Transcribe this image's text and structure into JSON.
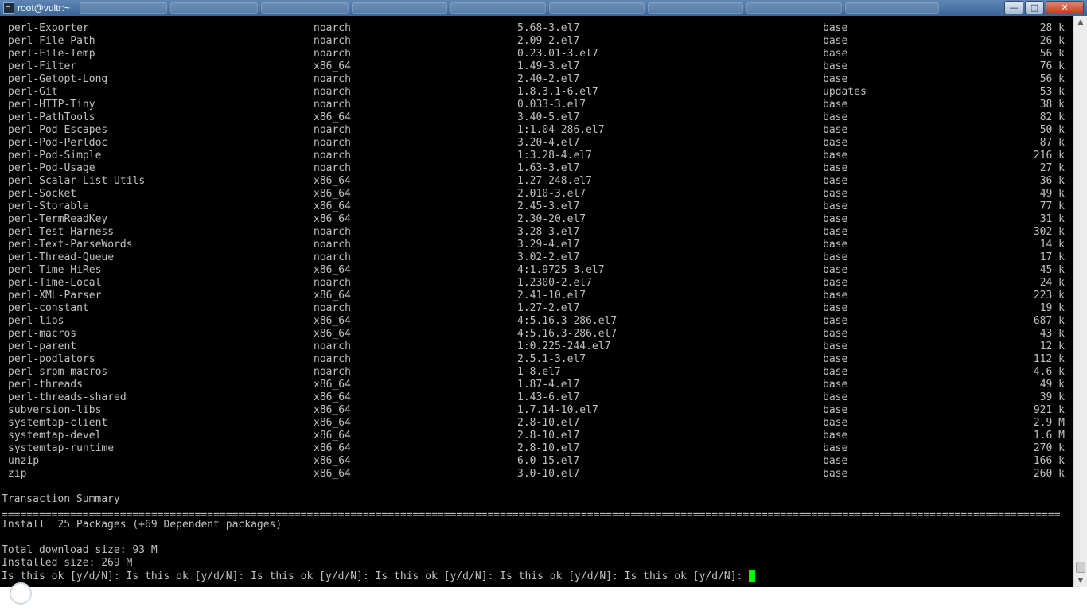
{
  "window": {
    "title": "root@vultr:~"
  },
  "packages": [
    {
      "name": "perl-Exporter",
      "arch": "noarch",
      "version": "5.68-3.el7",
      "repo": "base",
      "size": "28 k"
    },
    {
      "name": "perl-File-Path",
      "arch": "noarch",
      "version": "2.09-2.el7",
      "repo": "base",
      "size": "26 k"
    },
    {
      "name": "perl-File-Temp",
      "arch": "noarch",
      "version": "0.23.01-3.el7",
      "repo": "base",
      "size": "56 k"
    },
    {
      "name": "perl-Filter",
      "arch": "x86_64",
      "version": "1.49-3.el7",
      "repo": "base",
      "size": "76 k"
    },
    {
      "name": "perl-Getopt-Long",
      "arch": "noarch",
      "version": "2.40-2.el7",
      "repo": "base",
      "size": "56 k"
    },
    {
      "name": "perl-Git",
      "arch": "noarch",
      "version": "1.8.3.1-6.el7",
      "repo": "updates",
      "size": "53 k"
    },
    {
      "name": "perl-HTTP-Tiny",
      "arch": "noarch",
      "version": "0.033-3.el7",
      "repo": "base",
      "size": "38 k"
    },
    {
      "name": "perl-PathTools",
      "arch": "x86_64",
      "version": "3.40-5.el7",
      "repo": "base",
      "size": "82 k"
    },
    {
      "name": "perl-Pod-Escapes",
      "arch": "noarch",
      "version": "1:1.04-286.el7",
      "repo": "base",
      "size": "50 k"
    },
    {
      "name": "perl-Pod-Perldoc",
      "arch": "noarch",
      "version": "3.20-4.el7",
      "repo": "base",
      "size": "87 k"
    },
    {
      "name": "perl-Pod-Simple",
      "arch": "noarch",
      "version": "1:3.28-4.el7",
      "repo": "base",
      "size": "216 k"
    },
    {
      "name": "perl-Pod-Usage",
      "arch": "noarch",
      "version": "1.63-3.el7",
      "repo": "base",
      "size": "27 k"
    },
    {
      "name": "perl-Scalar-List-Utils",
      "arch": "x86_64",
      "version": "1.27-248.el7",
      "repo": "base",
      "size": "36 k"
    },
    {
      "name": "perl-Socket",
      "arch": "x86_64",
      "version": "2.010-3.el7",
      "repo": "base",
      "size": "49 k"
    },
    {
      "name": "perl-Storable",
      "arch": "x86_64",
      "version": "2.45-3.el7",
      "repo": "base",
      "size": "77 k"
    },
    {
      "name": "perl-TermReadKey",
      "arch": "x86_64",
      "version": "2.30-20.el7",
      "repo": "base",
      "size": "31 k"
    },
    {
      "name": "perl-Test-Harness",
      "arch": "noarch",
      "version": "3.28-3.el7",
      "repo": "base",
      "size": "302 k"
    },
    {
      "name": "perl-Text-ParseWords",
      "arch": "noarch",
      "version": "3.29-4.el7",
      "repo": "base",
      "size": "14 k"
    },
    {
      "name": "perl-Thread-Queue",
      "arch": "noarch",
      "version": "3.02-2.el7",
      "repo": "base",
      "size": "17 k"
    },
    {
      "name": "perl-Time-HiRes",
      "arch": "x86_64",
      "version": "4:1.9725-3.el7",
      "repo": "base",
      "size": "45 k"
    },
    {
      "name": "perl-Time-Local",
      "arch": "noarch",
      "version": "1.2300-2.el7",
      "repo": "base",
      "size": "24 k"
    },
    {
      "name": "perl-XML-Parser",
      "arch": "x86_64",
      "version": "2.41-10.el7",
      "repo": "base",
      "size": "223 k"
    },
    {
      "name": "perl-constant",
      "arch": "noarch",
      "version": "1.27-2.el7",
      "repo": "base",
      "size": "19 k"
    },
    {
      "name": "perl-libs",
      "arch": "x86_64",
      "version": "4:5.16.3-286.el7",
      "repo": "base",
      "size": "687 k"
    },
    {
      "name": "perl-macros",
      "arch": "x86_64",
      "version": "4:5.16.3-286.el7",
      "repo": "base",
      "size": "43 k"
    },
    {
      "name": "perl-parent",
      "arch": "noarch",
      "version": "1:0.225-244.el7",
      "repo": "base",
      "size": "12 k"
    },
    {
      "name": "perl-podlators",
      "arch": "noarch",
      "version": "2.5.1-3.el7",
      "repo": "base",
      "size": "112 k"
    },
    {
      "name": "perl-srpm-macros",
      "arch": "noarch",
      "version": "1-8.el7",
      "repo": "base",
      "size": "4.6 k"
    },
    {
      "name": "perl-threads",
      "arch": "x86_64",
      "version": "1.87-4.el7",
      "repo": "base",
      "size": "49 k"
    },
    {
      "name": "perl-threads-shared",
      "arch": "x86_64",
      "version": "1.43-6.el7",
      "repo": "base",
      "size": "39 k"
    },
    {
      "name": "subversion-libs",
      "arch": "x86_64",
      "version": "1.7.14-10.el7",
      "repo": "base",
      "size": "921 k"
    },
    {
      "name": "systemtap-client",
      "arch": "x86_64",
      "version": "2.8-10.el7",
      "repo": "base",
      "size": "2.9 M"
    },
    {
      "name": "systemtap-devel",
      "arch": "x86_64",
      "version": "2.8-10.el7",
      "repo": "base",
      "size": "1.6 M"
    },
    {
      "name": "systemtap-runtime",
      "arch": "x86_64",
      "version": "2.8-10.el7",
      "repo": "base",
      "size": "270 k"
    },
    {
      "name": "unzip",
      "arch": "x86_64",
      "version": "6.0-15.el7",
      "repo": "base",
      "size": "166 k"
    },
    {
      "name": "zip",
      "arch": "x86_64",
      "version": "3.0-10.el7",
      "repo": "base",
      "size": "260 k"
    }
  ],
  "summary": {
    "heading": "Transaction Summary",
    "separator": "==========================================================================================================================================================================",
    "install_line": "Install  25 Packages (+69 Dependent packages)",
    "download_size": "Total download size: 93 M",
    "installed_size": "Installed size: 269 M",
    "prompt": "Is this ok [y/d/N]: Is this ok [y/d/N]: Is this ok [y/d/N]: Is this ok [y/d/N]: Is this ok [y/d/N]: Is this ok [y/d/N]: "
  },
  "colors": {
    "terminal_bg": "#000000",
    "terminal_fg": "#c0c0c0",
    "cursor": "#00ff00",
    "titlebar": "#4a74a6",
    "close_button": "#c0392b"
  },
  "icons": {
    "app": "putty-terminal-icon",
    "minimize": "minimize-icon",
    "maximize": "maximize-icon",
    "close": "close-icon"
  }
}
